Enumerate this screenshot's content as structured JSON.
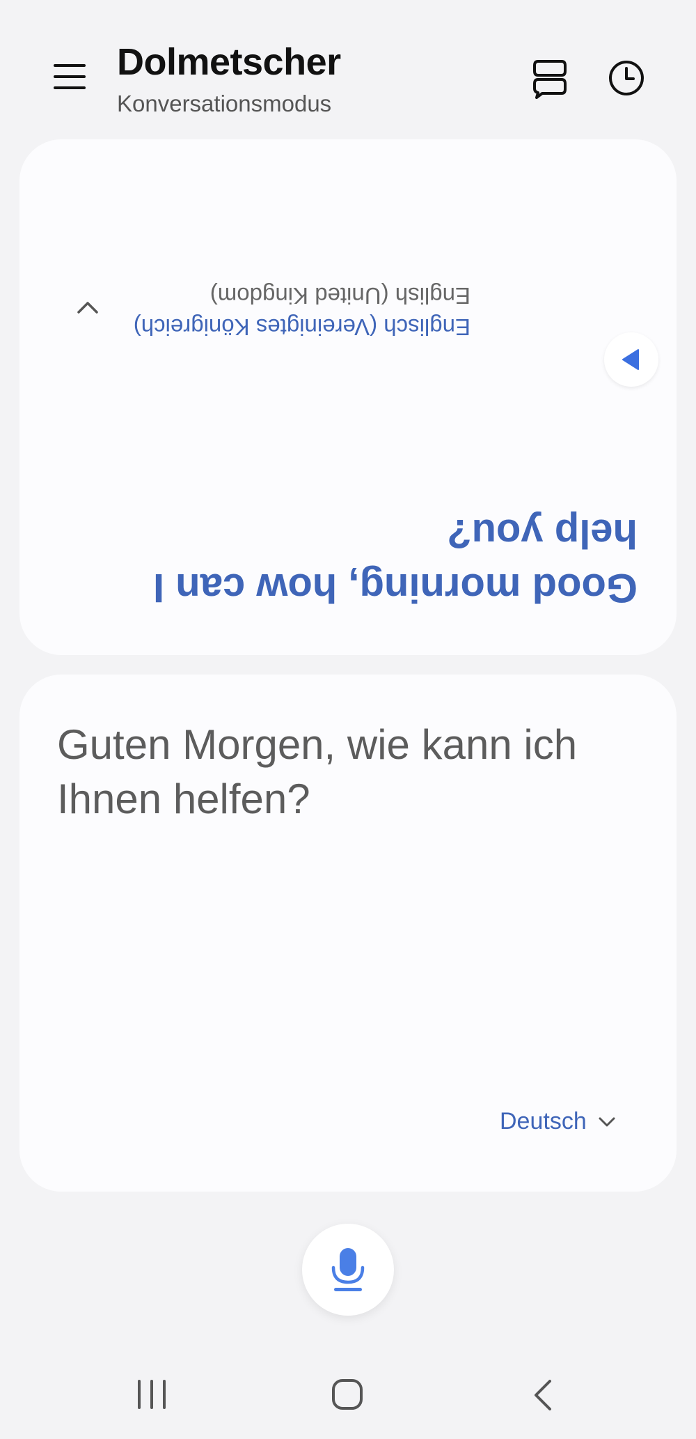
{
  "header": {
    "title": "Dolmetscher",
    "subtitle": "Konversationsmodus"
  },
  "top_card": {
    "translation": "Good morning, how can I help you?",
    "language_primary": "Englisch (Vereinigtes Königreich)",
    "language_secondary": "English (United Kingdom)"
  },
  "bottom_card": {
    "source_text": "Guten Morgen, wie kann ich Ihnen helfen?",
    "language": "Deutsch"
  },
  "icons": {
    "menu": "hamburger-menu-icon",
    "split": "split-screen-icon",
    "history": "clock-history-icon",
    "speak": "play-speaker-icon",
    "expand": "chevron-up-icon",
    "dropdown": "chevron-down-icon",
    "mic": "microphone-icon",
    "nav_recent": "recent-apps-icon",
    "nav_home": "home-icon",
    "nav_back": "back-icon"
  },
  "colors": {
    "accent": "#3f65b8",
    "mic_blue": "#4a7fe6",
    "background": "#f3f3f5",
    "card": "#fcfcfe"
  }
}
